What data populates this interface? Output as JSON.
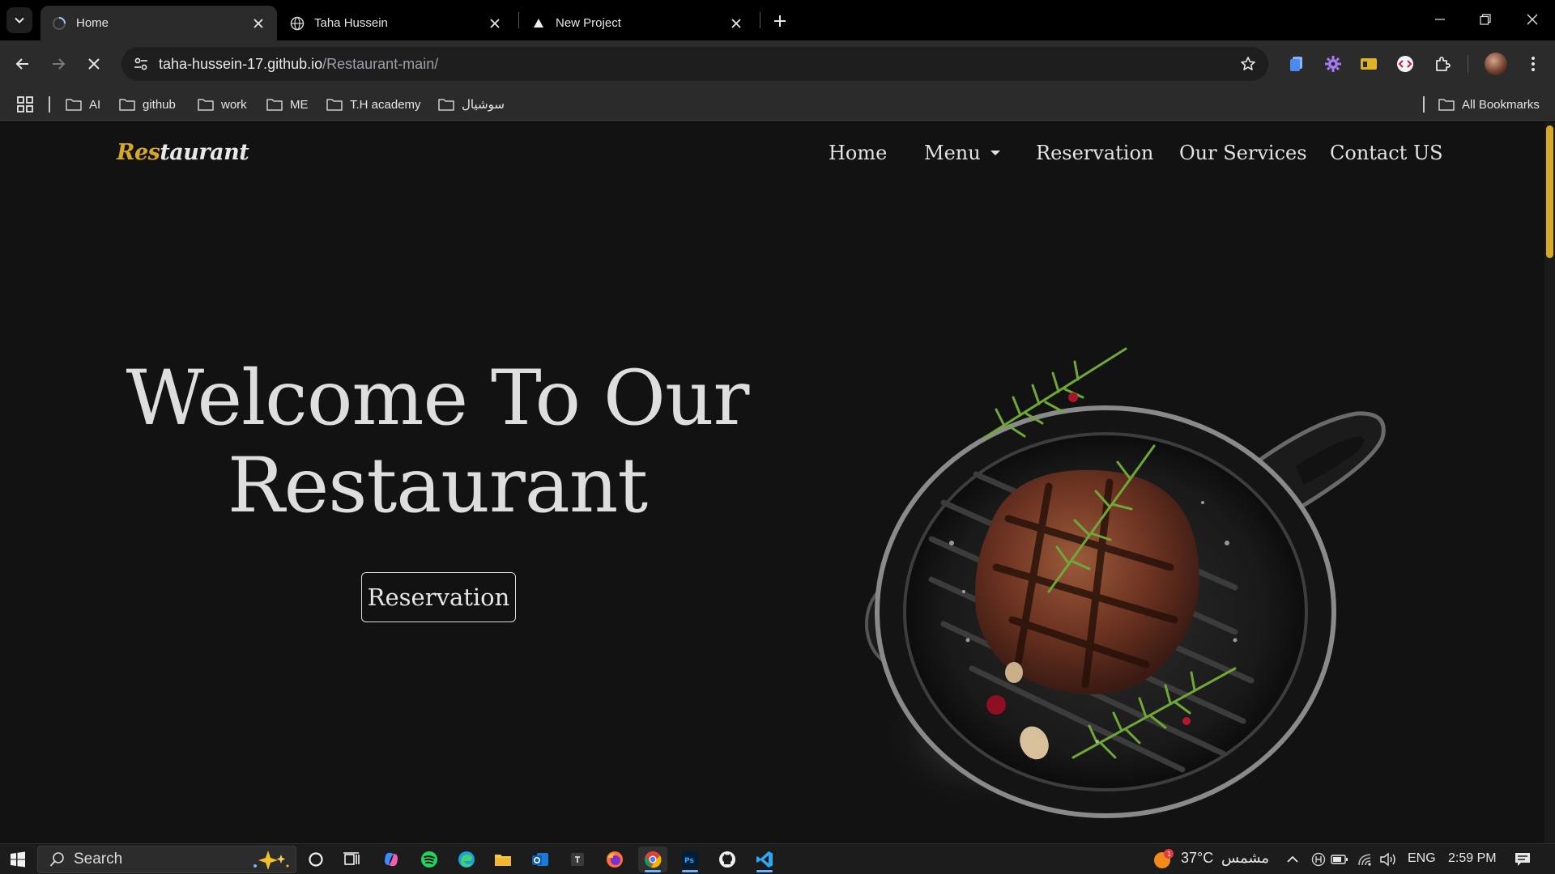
{
  "browser": {
    "tabs": [
      {
        "title": "Home",
        "active": true
      },
      {
        "title": "Taha Hussein",
        "active": false
      },
      {
        "title": "New Project",
        "active": false
      }
    ],
    "url": {
      "host": "taha-hussein-17.github.io",
      "path": "/Restaurant-main/"
    },
    "bookmarks": [
      "AI",
      "github",
      "work",
      "ME",
      "T.H academy",
      "سوشيال"
    ],
    "all_bookmarks_label": "All Bookmarks"
  },
  "page": {
    "brand": {
      "accent": "Res",
      "rest": "taurant"
    },
    "nav": [
      "Home",
      "Menu",
      "Reservation",
      "Our Services",
      "Contact US"
    ],
    "hero": {
      "title_line1": "Welcome To Our",
      "title_line2": "Restaurant",
      "cta_label": "Reservation"
    },
    "colors": {
      "accent": "#d4a62a",
      "background": "#121212"
    }
  },
  "taskbar": {
    "search_placeholder": "Search",
    "weather_temp": "37°C",
    "weather_condition": "مشمس",
    "weather_badge": "1",
    "language": "ENG",
    "time": "2:59 PM"
  }
}
